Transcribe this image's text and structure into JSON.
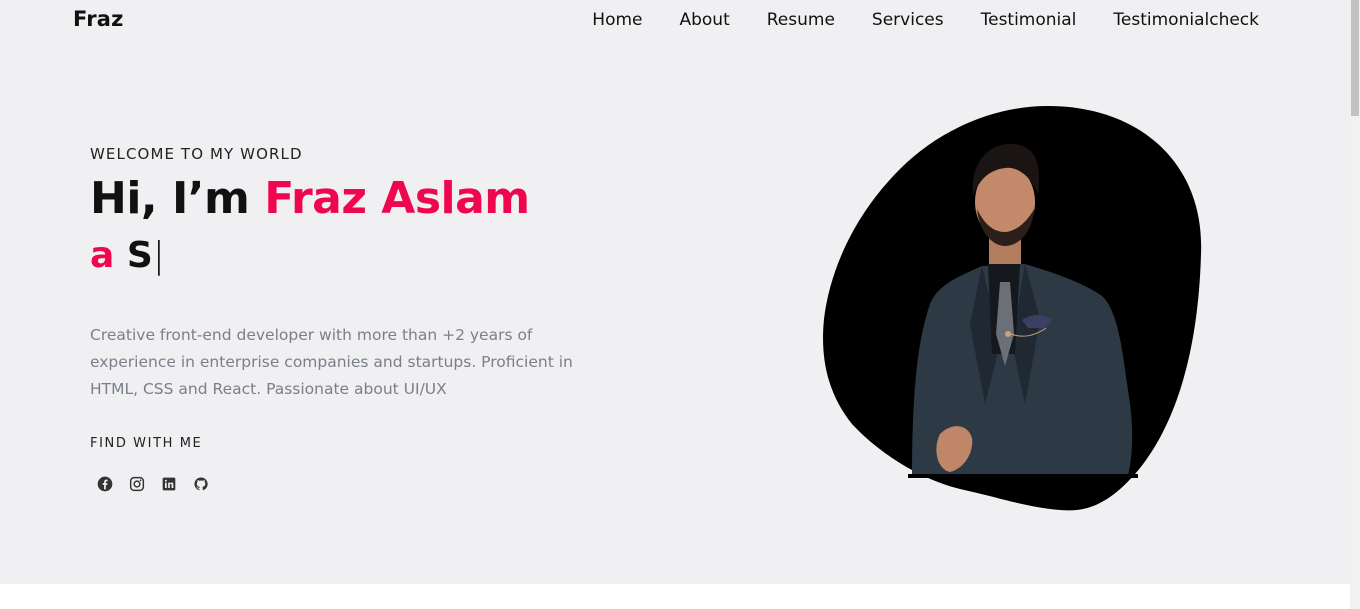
{
  "nav": {
    "brand": "Fraz",
    "links": [
      "Home",
      "About",
      "Resume",
      "Services",
      "Testimonial",
      "Testimonialcheck"
    ]
  },
  "hero": {
    "eyebrow": "WELCOME TO MY WORLD",
    "greeting": "Hi, I’m ",
    "name": "Fraz Aslam",
    "typed_prefix": "a ",
    "typed_text": "S",
    "cursor": "|",
    "bio": "Creative front-end developer with more than +2 years of experience in enterprise companies and startups. Proficient in HTML, CSS and React. Passionate about UI/UX",
    "find_label": "FIND WITH ME",
    "socials": [
      "facebook-icon",
      "instagram-icon",
      "linkedin-icon",
      "github-icon"
    ]
  },
  "colors": {
    "background": "#f0f0f2",
    "accent": "#f0064e",
    "text": "#111111",
    "muted": "#7a7f8a",
    "blob": "#000000"
  }
}
